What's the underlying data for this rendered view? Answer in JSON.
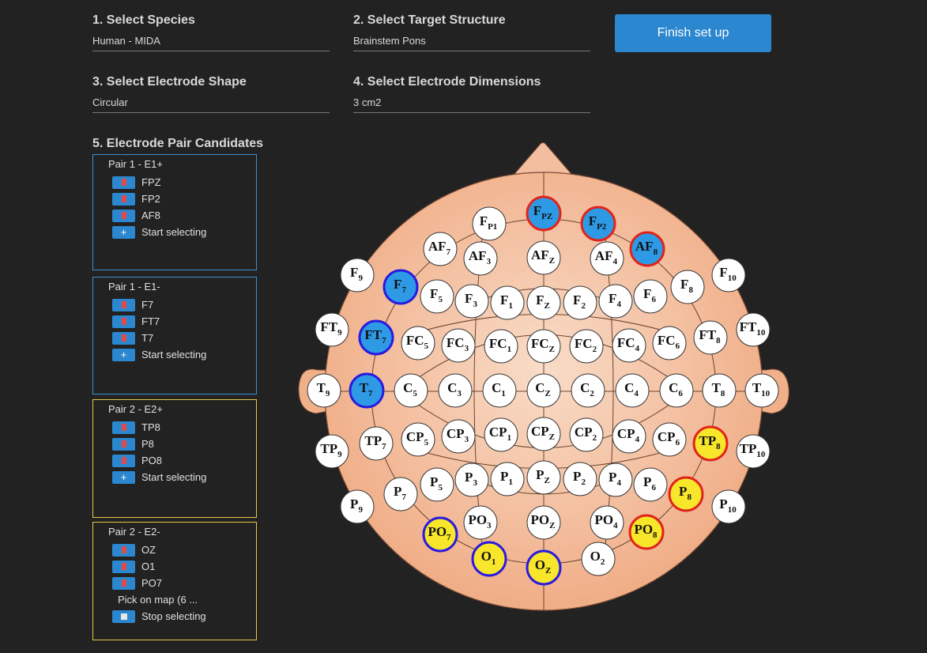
{
  "fields": [
    {
      "id": "species",
      "label": "1. Select Species",
      "value": "Human - MIDA"
    },
    {
      "id": "target",
      "label": "2. Select Target Structure",
      "value": "Brainstem Pons"
    },
    {
      "id": "shape",
      "label": "3. Select Electrode Shape",
      "value": "Circular"
    },
    {
      "id": "dimensions",
      "label": "4. Select Electrode Dimensions",
      "value": "3 cm2"
    }
  ],
  "finish_button": "Finish set up",
  "candidates_title": "5. Electrode Pair Candidates",
  "pairs": [
    {
      "title": "Pair 1 - E1+",
      "color": "blue",
      "electrodes": [
        "FPZ",
        "FP2",
        "AF8"
      ],
      "action": "Start selecting",
      "note": ""
    },
    {
      "title": "Pair 1 - E1-",
      "color": "blue",
      "electrodes": [
        "F7",
        "FT7",
        "T7"
      ],
      "action": "Start selecting",
      "note": ""
    },
    {
      "title": "Pair 2 - E2+",
      "color": "yellow",
      "electrodes": [
        "TP8",
        "P8",
        "PO8"
      ],
      "action": "Start selecting",
      "note": ""
    },
    {
      "title": "Pair 2 - E2-",
      "color": "yellow",
      "electrodes": [
        "OZ",
        "O1",
        "PO7"
      ],
      "action": "Stop selecting",
      "note": "Pick on map (6 ..."
    }
  ],
  "colors": {
    "background": "#222222",
    "accent_blue": "#2b87cf",
    "electrode_blue": "#2e9ae6",
    "electrode_yellow": "#f7e62a",
    "ring_red": "#e0241c",
    "ring_purple": "#2a1adf",
    "head_skin": "#f2b48f"
  },
  "electrodes": [
    {
      "b": "F",
      "s": "PZ",
      "fill": "blue",
      "ring": "red"
    },
    {
      "b": "F",
      "s": "P2",
      "fill": "blue",
      "ring": "red"
    },
    {
      "b": "AF",
      "s": "8",
      "fill": "blue",
      "ring": "red"
    },
    {
      "b": "F",
      "s": "7",
      "fill": "blue",
      "ring": "purple"
    },
    {
      "b": "FT",
      "s": "7",
      "fill": "blue",
      "ring": "purple"
    },
    {
      "b": "T",
      "s": "7",
      "fill": "blue",
      "ring": "purple"
    },
    {
      "b": "TP",
      "s": "8",
      "fill": "yellow",
      "ring": "red"
    },
    {
      "b": "P",
      "s": "8",
      "fill": "yellow",
      "ring": "red"
    },
    {
      "b": "PO",
      "s": "8",
      "fill": "yellow",
      "ring": "red"
    },
    {
      "b": "PO",
      "s": "7",
      "fill": "yellow",
      "ring": "purple"
    },
    {
      "b": "O",
      "s": "1",
      "fill": "yellow",
      "ring": "purple"
    },
    {
      "b": "O",
      "s": "Z",
      "fill": "yellow",
      "ring": "purple"
    },
    {
      "b": "F",
      "s": "P1"
    },
    {
      "b": "AF",
      "s": "7"
    },
    {
      "b": "AF",
      "s": "3"
    },
    {
      "b": "AF",
      "s": "Z"
    },
    {
      "b": "AF",
      "s": "4"
    },
    {
      "b": "F",
      "s": "9"
    },
    {
      "b": "F",
      "s": "10"
    },
    {
      "b": "F",
      "s": "5"
    },
    {
      "b": "F",
      "s": "3"
    },
    {
      "b": "F",
      "s": "1"
    },
    {
      "b": "F",
      "s": "Z"
    },
    {
      "b": "F",
      "s": "2"
    },
    {
      "b": "F",
      "s": "4"
    },
    {
      "b": "F",
      "s": "6"
    },
    {
      "b": "F",
      "s": "8"
    },
    {
      "b": "FT",
      "s": "9"
    },
    {
      "b": "FC",
      "s": "5"
    },
    {
      "b": "FC",
      "s": "3"
    },
    {
      "b": "FC",
      "s": "1"
    },
    {
      "b": "FC",
      "s": "Z"
    },
    {
      "b": "FC",
      "s": "2"
    },
    {
      "b": "FC",
      "s": "4"
    },
    {
      "b": "FC",
      "s": "6"
    },
    {
      "b": "FT",
      "s": "8"
    },
    {
      "b": "FT",
      "s": "10"
    },
    {
      "b": "T",
      "s": "9"
    },
    {
      "b": "C",
      "s": "5"
    },
    {
      "b": "C",
      "s": "3"
    },
    {
      "b": "C",
      "s": "1"
    },
    {
      "b": "C",
      "s": "Z"
    },
    {
      "b": "C",
      "s": "2"
    },
    {
      "b": "C",
      "s": "4"
    },
    {
      "b": "C",
      "s": "6"
    },
    {
      "b": "T",
      "s": "8"
    },
    {
      "b": "T",
      "s": "10"
    },
    {
      "b": "TP",
      "s": "9"
    },
    {
      "b": "TP",
      "s": "7"
    },
    {
      "b": "CP",
      "s": "5"
    },
    {
      "b": "CP",
      "s": "3"
    },
    {
      "b": "CP",
      "s": "1"
    },
    {
      "b": "CP",
      "s": "Z"
    },
    {
      "b": "CP",
      "s": "2"
    },
    {
      "b": "CP",
      "s": "4"
    },
    {
      "b": "CP",
      "s": "6"
    },
    {
      "b": "TP",
      "s": "10"
    },
    {
      "b": "P",
      "s": "7"
    },
    {
      "b": "P",
      "s": "5"
    },
    {
      "b": "P",
      "s": "3"
    },
    {
      "b": "P",
      "s": "1"
    },
    {
      "b": "P",
      "s": "Z"
    },
    {
      "b": "P",
      "s": "2"
    },
    {
      "b": "P",
      "s": "4"
    },
    {
      "b": "P",
      "s": "6"
    },
    {
      "b": "P",
      "s": "9"
    },
    {
      "b": "P",
      "s": "10"
    },
    {
      "b": "PO",
      "s": "3"
    },
    {
      "b": "PO",
      "s": "Z"
    },
    {
      "b": "PO",
      "s": "4"
    },
    {
      "b": "O",
      "s": "2"
    }
  ]
}
